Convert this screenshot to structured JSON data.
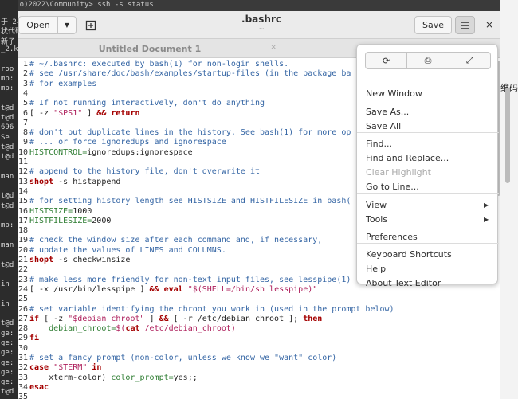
{
  "background": {
    "top_text": "tudio)2022\\Community> ssh -s status",
    "terminal_lines": [
      "于 24",
      "状代码",
      "新子",
      "_2.ka",
      "",
      "roo",
      "mp:",
      "mp:",
      "",
      "t@d",
      "t@d",
      "696",
      "Se",
      "t@d",
      "t@d",
      "",
      "man",
      "",
      "t@d",
      "t@d",
      "",
      "mp:",
      "",
      "man",
      "",
      "t@d",
      "",
      "in",
      "",
      "in",
      "",
      "t@d",
      "ge:",
      "ge:",
      "ge:",
      "ge:",
      "ge:",
      "ge:",
      "t@d"
    ],
    "right_text": "维码"
  },
  "header": {
    "open_label": "Open",
    "open_dropdown_icon": "triangle-down-icon",
    "new_tab_icon": "new-document-icon",
    "title": ".bashrc",
    "subtitle": "~",
    "save_label": "Save",
    "menu_icon": "hamburger-icon",
    "close_glyph": "×"
  },
  "tabs": [
    {
      "label": "Untitled Document 1",
      "close": "×"
    }
  ],
  "editor": {
    "lines": [
      {
        "n": "1",
        "parts": [
          {
            "c": "c",
            "t": "# ~/.bashrc: executed by bash(1) for non-login shells."
          }
        ]
      },
      {
        "n": "2",
        "parts": [
          {
            "c": "c",
            "t": "# see /usr/share/doc/bash/examples/startup-files (in the package ba"
          }
        ]
      },
      {
        "n": "3",
        "parts": [
          {
            "c": "c",
            "t": "# for examples"
          }
        ]
      },
      {
        "n": "4",
        "parts": []
      },
      {
        "n": "5",
        "parts": [
          {
            "c": "c",
            "t": "# If not running interactively, don't do anything"
          }
        ]
      },
      {
        "n": "6",
        "parts": [
          {
            "c": "t",
            "t": "[ -z "
          },
          {
            "c": "s",
            "t": "\"$PS1\""
          },
          {
            "c": "t",
            "t": " ] "
          },
          {
            "c": "k",
            "t": "&& return"
          }
        ]
      },
      {
        "n": "7",
        "parts": []
      },
      {
        "n": "8",
        "parts": [
          {
            "c": "c",
            "t": "# don't put duplicate lines in the history. See bash(1) for more op"
          }
        ]
      },
      {
        "n": "9",
        "parts": [
          {
            "c": "c",
            "t": "# ... or force ignoredups and ignorespace"
          }
        ]
      },
      {
        "n": "10",
        "parts": [
          {
            "c": "v",
            "t": "HISTCONTROL="
          },
          {
            "c": "t",
            "t": "ignoredups:ignorespace"
          }
        ]
      },
      {
        "n": "11",
        "parts": []
      },
      {
        "n": "12",
        "parts": [
          {
            "c": "c",
            "t": "# append to the history file, don't overwrite it"
          }
        ]
      },
      {
        "n": "13",
        "parts": [
          {
            "c": "k",
            "t": "shopt"
          },
          {
            "c": "t",
            "t": " -s histappend"
          }
        ]
      },
      {
        "n": "14",
        "parts": []
      },
      {
        "n": "15",
        "parts": [
          {
            "c": "c",
            "t": "# for setting history length see HISTSIZE and HISTFILESIZE in bash("
          }
        ]
      },
      {
        "n": "16",
        "parts": [
          {
            "c": "v",
            "t": "HISTSIZE="
          },
          {
            "c": "t",
            "t": "1000"
          }
        ]
      },
      {
        "n": "17",
        "parts": [
          {
            "c": "v",
            "t": "HISTFILESIZE="
          },
          {
            "c": "t",
            "t": "2000"
          }
        ]
      },
      {
        "n": "18",
        "parts": []
      },
      {
        "n": "19",
        "parts": [
          {
            "c": "c",
            "t": "# check the window size after each command and, if necessary,"
          }
        ]
      },
      {
        "n": "20",
        "parts": [
          {
            "c": "c",
            "t": "# update the values of LINES and COLUMNS."
          }
        ]
      },
      {
        "n": "21",
        "parts": [
          {
            "c": "k",
            "t": "shopt"
          },
          {
            "c": "t",
            "t": " -s checkwinsize"
          }
        ]
      },
      {
        "n": "22",
        "parts": []
      },
      {
        "n": "23",
        "parts": [
          {
            "c": "c",
            "t": "# make less more friendly for non-text input files, see lesspipe(1)"
          }
        ]
      },
      {
        "n": "24",
        "parts": [
          {
            "c": "t",
            "t": "[ -x /usr/bin/lesspipe ] "
          },
          {
            "c": "k",
            "t": "&& eval"
          },
          {
            "c": "t",
            "t": " "
          },
          {
            "c": "s",
            "t": "\"$(SHELL=/bin/sh lesspipe)\""
          }
        ]
      },
      {
        "n": "25",
        "parts": []
      },
      {
        "n": "26",
        "parts": [
          {
            "c": "c",
            "t": "# set variable identifying the chroot you work in (used in the prompt below)"
          }
        ]
      },
      {
        "n": "27",
        "parts": [
          {
            "c": "k",
            "t": "if"
          },
          {
            "c": "t",
            "t": " [ -z "
          },
          {
            "c": "s",
            "t": "\"$debian_chroot\""
          },
          {
            "c": "t",
            "t": " ] "
          },
          {
            "c": "k",
            "t": "&&"
          },
          {
            "c": "t",
            "t": " [ -r /etc/debian_chroot ]; "
          },
          {
            "c": "k",
            "t": "then"
          }
        ]
      },
      {
        "n": "28",
        "parts": [
          {
            "c": "t",
            "t": "    "
          },
          {
            "c": "v",
            "t": "debian_chroot="
          },
          {
            "c": "s",
            "t": "$("
          },
          {
            "c": "k",
            "t": "cat"
          },
          {
            "c": "s",
            "t": " /etc/debian_chroot)"
          }
        ]
      },
      {
        "n": "29",
        "parts": [
          {
            "c": "k",
            "t": "fi"
          }
        ]
      },
      {
        "n": "30",
        "parts": []
      },
      {
        "n": "31",
        "parts": [
          {
            "c": "c",
            "t": "# set a fancy prompt (non-color, unless we know we \"want\" color)"
          }
        ]
      },
      {
        "n": "32",
        "parts": [
          {
            "c": "k",
            "t": "case"
          },
          {
            "c": "t",
            "t": " "
          },
          {
            "c": "s",
            "t": "\"$TERM\""
          },
          {
            "c": "t",
            "t": " "
          },
          {
            "c": "k",
            "t": "in"
          }
        ]
      },
      {
        "n": "33",
        "parts": [
          {
            "c": "t",
            "t": "    xterm-color) "
          },
          {
            "c": "v",
            "t": "color_prompt="
          },
          {
            "c": "t",
            "t": "yes;;"
          }
        ]
      },
      {
        "n": "34",
        "parts": [
          {
            "c": "k",
            "t": "esac"
          }
        ]
      },
      {
        "n": "35",
        "parts": []
      },
      {
        "n": "36",
        "parts": [
          {
            "c": "c",
            "t": "# uncomment for a colored prompt, if the terminal has the capability; turned"
          }
        ]
      }
    ]
  },
  "menu": {
    "icon_buttons": [
      {
        "name": "reload-icon",
        "glyph": "⟳"
      },
      {
        "name": "print-icon",
        "glyph": "⎙"
      },
      {
        "name": "fullscreen-icon",
        "glyph": "⤢"
      }
    ],
    "items": [
      {
        "label": "New Window"
      },
      {
        "label": "Save As..."
      },
      {
        "label": "Save All"
      },
      {
        "label": "Find..."
      },
      {
        "label": "Find and Replace..."
      },
      {
        "label": "Clear Highlight",
        "disabled": true
      },
      {
        "label": "Go to Line..."
      },
      {
        "label": "View",
        "submenu": true
      },
      {
        "label": "Tools",
        "submenu": true
      },
      {
        "label": "Preferences"
      },
      {
        "label": "Keyboard Shortcuts"
      },
      {
        "label": "Help"
      },
      {
        "label": "About Text Editor"
      }
    ]
  }
}
